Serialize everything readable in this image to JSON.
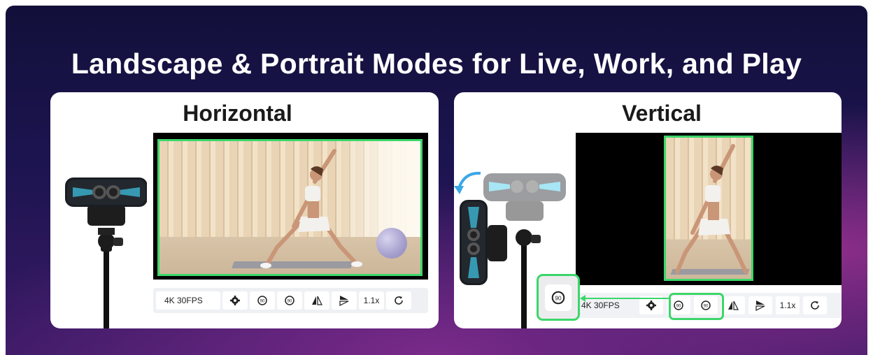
{
  "headline": "Landscape & Portrait Modes for Live, Work, and Play",
  "cards": {
    "horizontal": {
      "title": "Horizontal",
      "resolution": "4K 30FPS",
      "zoom": "1.1x"
    },
    "vertical": {
      "title": "Vertical",
      "resolution": "4K 30FPS",
      "zoom": "1.1x"
    }
  },
  "icons": {
    "rotate_left": "90",
    "rotate_right": "90",
    "big_rotate": "90"
  },
  "colors": {
    "highlight": "#3cd66a",
    "camera_accent": "#3ec9e8",
    "card_bg": "#ffffff"
  }
}
